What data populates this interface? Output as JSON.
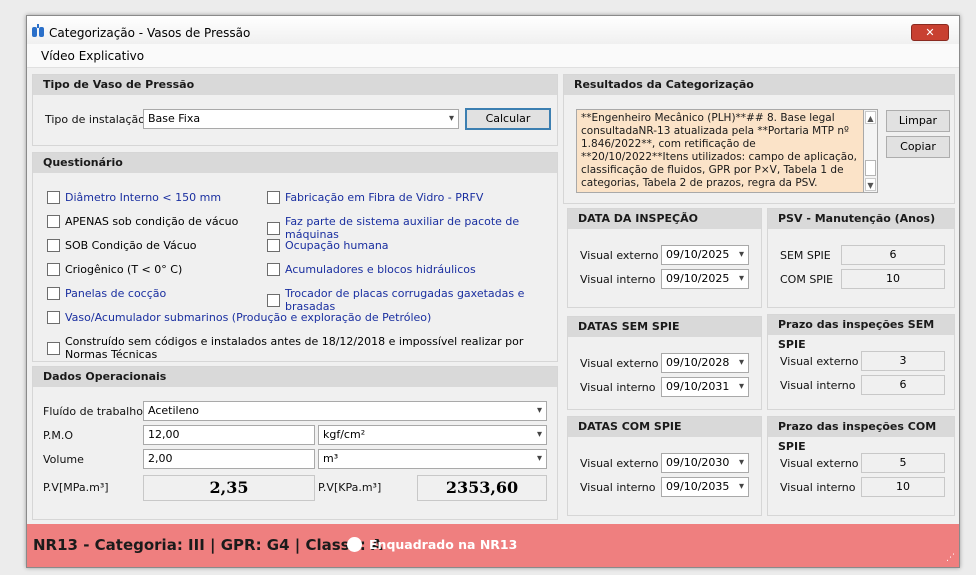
{
  "window": {
    "title": "Categorização - Vasos de Pressão",
    "close_label": "✕"
  },
  "menu": {
    "video": "Vídeo Explicativo"
  },
  "tipo": {
    "header": "Tipo de Vaso de Pressão",
    "label": "Tipo de instalação",
    "value": "Base Fixa",
    "calc_button": "Calcular"
  },
  "questionario": {
    "header": "Questionário",
    "left": [
      "Diâmetro Interno < 150 mm",
      "APENAS sob condição de vácuo",
      "SOB Condição de Vácuo",
      "Criogênico (T < 0° C)",
      "Panelas de cocção"
    ],
    "right": [
      "Fabricação em Fibra de Vidro - PRFV",
      "Faz parte de sistema auxiliar de pacote de máquinas",
      "Ocupação humana",
      "Acumuladores e blocos hidráulicos",
      "Trocador de placas corrugadas gaxetadas e brasadas"
    ],
    "full1": "Vaso/Acumulador submarinos (Produção e exploração de Petróleo)",
    "full2": "Construído sem códigos e instalados antes de 18/12/2018 e impossível realizar por Normas Técnicas"
  },
  "dados": {
    "header": "Dados Operacionais",
    "fluido_label": "Fluído de trabalho",
    "fluido_value": "Acetileno",
    "pmo_label": "P.M.O",
    "pmo_value": "12,00",
    "pmo_unit": "kgf/cm²",
    "volume_label": "Volume",
    "volume_value": "2,00",
    "volume_unit": "m³",
    "pv_mpa_label": "P.V[MPa.m³]",
    "pv_mpa_value": "2,35",
    "pv_kpa_label": "P.V[KPa.m³]",
    "pv_kpa_value": "2353,60"
  },
  "resultados": {
    "header": "Resultados da Categorização",
    "text": "**Engenheiro Mecânico (PLH)**## 8. Base legal consultadaNR-13 atualizada pela **Portaria MTP nº 1.846/2022**, com retificação de **20/10/2022**Itens utilizados: campo de aplicação, classificação de fluidos, GPR por P×V, Tabela 1 de categorias, Tabela 2 de prazos, regra da PSV.",
    "limpar": "Limpar",
    "copiar": "Copiar"
  },
  "inspecao": {
    "header": "DATA DA INSPEÇÃO",
    "ext_label": "Visual externo",
    "ext_value": "09/10/2025",
    "int_label": "Visual interno",
    "int_value": "09/10/2025"
  },
  "psv": {
    "header": "PSV - Manutenção (Anos)",
    "sem_label": "SEM SPIE",
    "sem_value": "6",
    "com_label": "COM SPIE",
    "com_value": "10"
  },
  "sem_spie": {
    "header": "DATAS SEM SPIE",
    "ext_label": "Visual externo",
    "ext_value": "09/10/2028",
    "int_label": "Visual interno",
    "int_value": "09/10/2031"
  },
  "prazo_sem": {
    "header": "Prazo das inspeções SEM SPIE",
    "ext_label": "Visual externo",
    "ext_value": "3",
    "int_label": "Visual interno",
    "int_value": "6"
  },
  "com_spie": {
    "header": "DATAS COM SPIE",
    "ext_label": "Visual externo",
    "ext_value": "09/10/2030",
    "int_label": "Visual interno",
    "int_value": "09/10/2035"
  },
  "prazo_com": {
    "header": "Prazo das inspeções COM SPIE",
    "ext_label": "Visual externo",
    "ext_value": "5",
    "int_label": "Visual interno",
    "int_value": "10"
  },
  "status": {
    "text": "NR13 - Categoria: III | GPR: G4 | Classe: A",
    "tag": "Enquadrado na NR13",
    "color": "#ef7f7f"
  }
}
